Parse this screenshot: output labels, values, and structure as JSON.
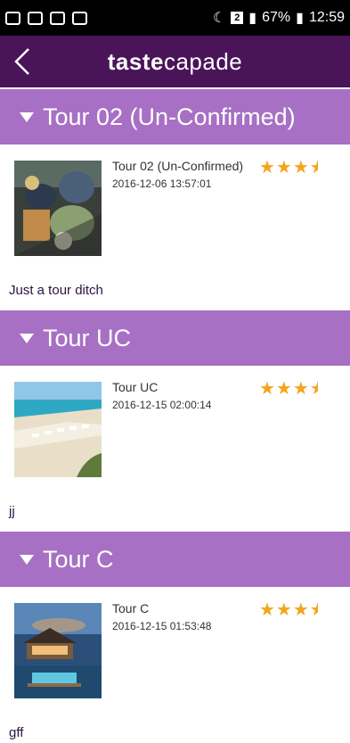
{
  "status": {
    "battery": "67%",
    "time": "12:59",
    "sim": "2"
  },
  "header": {
    "brand_bold": "taste",
    "brand_light": "capade"
  },
  "tours": [
    {
      "section_title": "Tour 02 (Un-Confirmed)",
      "item_title": "Tour 02 (Un-Confirmed)",
      "date": "2016-12-06 13:57:01",
      "rating": 3.5,
      "stars": "★★★",
      "description": "Just a tour ditch"
    },
    {
      "section_title": "Tour UC",
      "item_title": "Tour UC",
      "date": "2016-12-15 02:00:14",
      "rating": 3.5,
      "stars": "★★★",
      "description": "jj"
    },
    {
      "section_title": "Tour C",
      "item_title": "Tour C",
      "date": "2016-12-15 01:53:48",
      "rating": 3.5,
      "stars": "★★★",
      "description": "gff"
    }
  ]
}
